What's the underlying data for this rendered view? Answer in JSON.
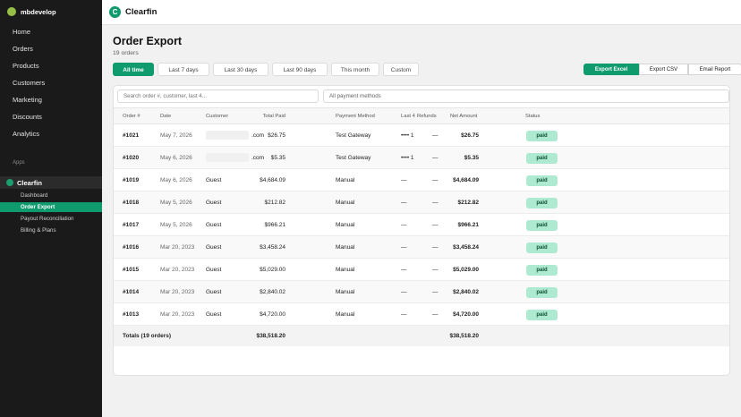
{
  "store": {
    "name": "mbdevelop"
  },
  "sidebar": {
    "items": [
      {
        "label": "Home"
      },
      {
        "label": "Orders"
      },
      {
        "label": "Products"
      },
      {
        "label": "Customers"
      },
      {
        "label": "Marketing"
      },
      {
        "label": "Discounts"
      },
      {
        "label": "Analytics"
      }
    ],
    "apps_label": "Apps",
    "app_name": "Clearfin",
    "app_items": [
      {
        "label": "Dashboard",
        "active": false
      },
      {
        "label": "Order Export",
        "active": true
      },
      {
        "label": "Payout Reconciliation",
        "active": false
      },
      {
        "label": "Billing & Plans",
        "active": false
      }
    ]
  },
  "topbar": {
    "brand": "Clearfin",
    "logo_letter": "C"
  },
  "page": {
    "title": "Order Export",
    "subtitle": "19 orders"
  },
  "filters": [
    {
      "label": "All time",
      "active": true
    },
    {
      "label": "Last 7 days",
      "active": false
    },
    {
      "label": "Last 30 days",
      "active": false
    },
    {
      "label": "Last 90 days",
      "active": false
    },
    {
      "label": "This month",
      "active": false
    },
    {
      "label": "Custom",
      "active": false
    }
  ],
  "exports": [
    {
      "label": "Export Excel"
    },
    {
      "label": "Export CSV"
    },
    {
      "label": "Email Report"
    }
  ],
  "search": {
    "placeholder": "Search order #, customer, last 4..."
  },
  "payment_filter": {
    "value": "All payment methods"
  },
  "table": {
    "headers": [
      "Order #",
      "Date",
      "Customer",
      "Total Paid",
      "Payment Method",
      "Last 4",
      "Refunds",
      "Net Amount",
      "Status"
    ],
    "rows": [
      {
        "order": "#1021",
        "date": "May 7, 2026",
        "customer": ".com",
        "redacted": true,
        "total": "$26.75",
        "method": "Test Gateway",
        "last4": "•••• 1",
        "refunds": "—",
        "net": "$26.75",
        "status": "paid"
      },
      {
        "order": "#1020",
        "date": "May 6, 2026",
        "customer": ".com",
        "redacted": true,
        "total": "$5.35",
        "method": "Test Gateway",
        "last4": "•••• 1",
        "refunds": "—",
        "net": "$5.35",
        "status": "paid"
      },
      {
        "order": "#1019",
        "date": "May 6, 2026",
        "customer": "Guest",
        "redacted": false,
        "total": "$4,684.09",
        "method": "Manual",
        "last4": "—",
        "refunds": "—",
        "net": "$4,684.09",
        "status": "paid"
      },
      {
        "order": "#1018",
        "date": "May 5, 2026",
        "customer": "Guest",
        "redacted": false,
        "total": "$212.82",
        "method": "Manual",
        "last4": "—",
        "refunds": "—",
        "net": "$212.82",
        "status": "paid"
      },
      {
        "order": "#1017",
        "date": "May 5, 2026",
        "customer": "Guest",
        "redacted": false,
        "total": "$966.21",
        "method": "Manual",
        "last4": "—",
        "refunds": "—",
        "net": "$966.21",
        "status": "paid"
      },
      {
        "order": "#1016",
        "date": "Mar 20, 2023",
        "customer": "Guest",
        "redacted": false,
        "total": "$3,458.24",
        "method": "Manual",
        "last4": "—",
        "refunds": "—",
        "net": "$3,458.24",
        "status": "paid"
      },
      {
        "order": "#1015",
        "date": "Mar 20, 2023",
        "customer": "Guest",
        "redacted": false,
        "total": "$5,029.00",
        "method": "Manual",
        "last4": "—",
        "refunds": "—",
        "net": "$5,029.00",
        "status": "paid"
      },
      {
        "order": "#1014",
        "date": "Mar 20, 2023",
        "customer": "Guest",
        "redacted": false,
        "total": "$2,840.02",
        "method": "Manual",
        "last4": "—",
        "refunds": "—",
        "net": "$2,840.02",
        "status": "paid"
      },
      {
        "order": "#1013",
        "date": "Mar 20, 2023",
        "customer": "Guest",
        "redacted": false,
        "total": "$4,720.00",
        "method": "Manual",
        "last4": "—",
        "refunds": "—",
        "net": "$4,720.00",
        "status": "paid"
      }
    ],
    "totals": {
      "label": "Totals (19 orders)",
      "total": "$38,518.20",
      "net": "$38,518.20"
    }
  },
  "colors": {
    "accent": "#0f9b6d",
    "sidebar": "#1a1a1a",
    "badge_bg": "#aee9d1",
    "badge_text": "#0c5132"
  }
}
